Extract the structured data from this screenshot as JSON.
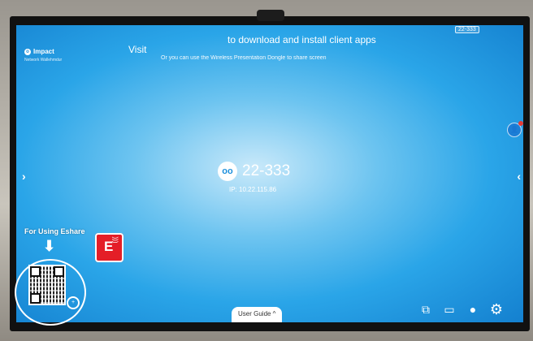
{
  "screen": {
    "brand": {
      "name": "Impact",
      "subtitle": "Network Wallehmdur"
    },
    "header": {
      "visit": "Visit",
      "download": "to download and install client apps",
      "dongle_note": "Or you can use the Wireless Presentation Dongle to share screen"
    },
    "room_badge": "22-333",
    "center": {
      "name": "22-333",
      "ip": "IP: 10.22.115.86"
    },
    "user_guide": "User Guide ^",
    "notification": {
      "badge": "1"
    }
  },
  "signage": {
    "caption": "For Using Eshare",
    "eshare_letter": "E"
  },
  "icons": [
    "share-screen-icon",
    "device-icon",
    "user-icon",
    "gear-icon",
    "zoom-icon"
  ]
}
